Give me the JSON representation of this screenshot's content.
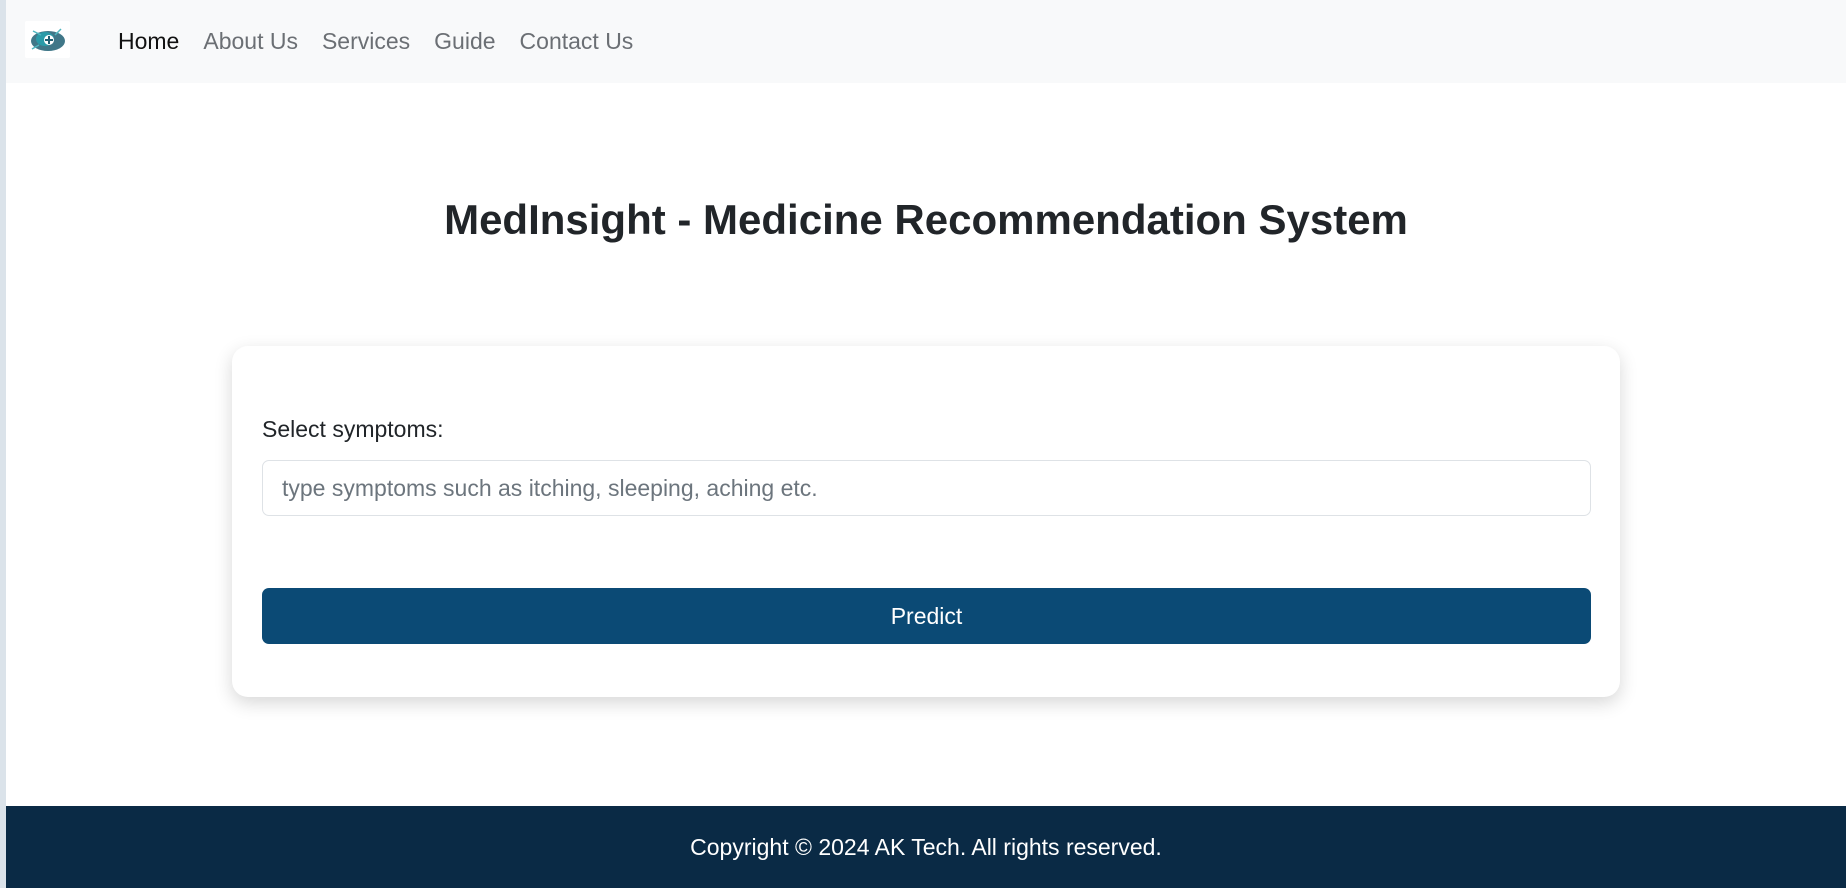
{
  "navbar": {
    "logo_icon": "medical-logo-icon",
    "links": [
      {
        "label": "Home",
        "active": true
      },
      {
        "label": "About Us",
        "active": false
      },
      {
        "label": "Services",
        "active": false
      },
      {
        "label": "Guide",
        "active": false
      },
      {
        "label": "Contact Us",
        "active": false
      }
    ]
  },
  "main": {
    "title": "MedInsight - Medicine Recommendation System",
    "form": {
      "symptoms_label": "Select symptoms:",
      "symptoms_value": "",
      "symptoms_placeholder": "type symptoms such as itching, sleeping, aching etc.",
      "predict_label": "Predict"
    }
  },
  "footer": {
    "copyright": "Copyright © 2024 AK Tech. All rights reserved."
  },
  "colors": {
    "navbar_bg": "#f8f9fa",
    "button_bg": "#0b4a75",
    "footer_bg": "#0a2a45",
    "text_dark": "#212529",
    "nav_muted": "#6b6f74"
  }
}
